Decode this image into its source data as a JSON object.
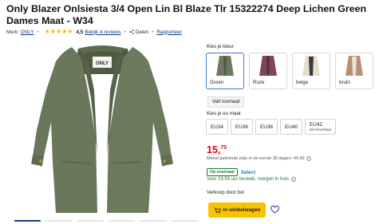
{
  "product": {
    "title": "Only Blazer Onlsiesta 3/4 Open Lin Bl Blaze Tlr 15322274 Deep Lichen Green Dames Maat - W34"
  },
  "meta": {
    "brand_prefix": "Merk:",
    "brand": "ONLY",
    "rating": 4.5,
    "rating_text": "4,5",
    "reviews_link": "Bekijk 4 reviews",
    "share": "Delen",
    "report": "Rapporteer"
  },
  "color": {
    "label": "Kies je kleur",
    "options": [
      {
        "name": "Groen",
        "swatch": "#6d7a5e",
        "selected": true
      },
      {
        "name": "Roze",
        "swatch": "#7d4755",
        "selected": false
      },
      {
        "name": "beige",
        "swatch": "#e7ddcd",
        "selected": false
      },
      {
        "name": "bruin",
        "swatch": "#b88e74",
        "selected": false
      }
    ]
  },
  "fit": {
    "label": "Valt normaal"
  },
  "size": {
    "label": "Kies je eu maat",
    "options": [
      {
        "label": "EU34",
        "sub": ""
      },
      {
        "label": "EU36",
        "sub": ""
      },
      {
        "label": "EU38",
        "sub": ""
      },
      {
        "label": "EU40",
        "sub": ""
      },
      {
        "label": "EU42",
        "sub": "Niet leverbaar"
      }
    ]
  },
  "price": {
    "whole": "15,",
    "cents": "75",
    "lowest_note": "Meest getoonde prijs in de eerste 30 dagen: 44,99"
  },
  "stock": {
    "badge": "Op voorraad",
    "select": "Select",
    "delivery": "Voor 23:59 uur besteld, morgen in huis"
  },
  "seller": {
    "text": "Verkoop door bol"
  },
  "cart": {
    "label": "In winkelwagen"
  },
  "colors": {
    "price_red": "#e4001b",
    "cart_yellow": "#f8c400",
    "link_blue": "#0a3a8a",
    "green": "#1f7a2e"
  },
  "image": {
    "brand_tag": "ONLY"
  }
}
